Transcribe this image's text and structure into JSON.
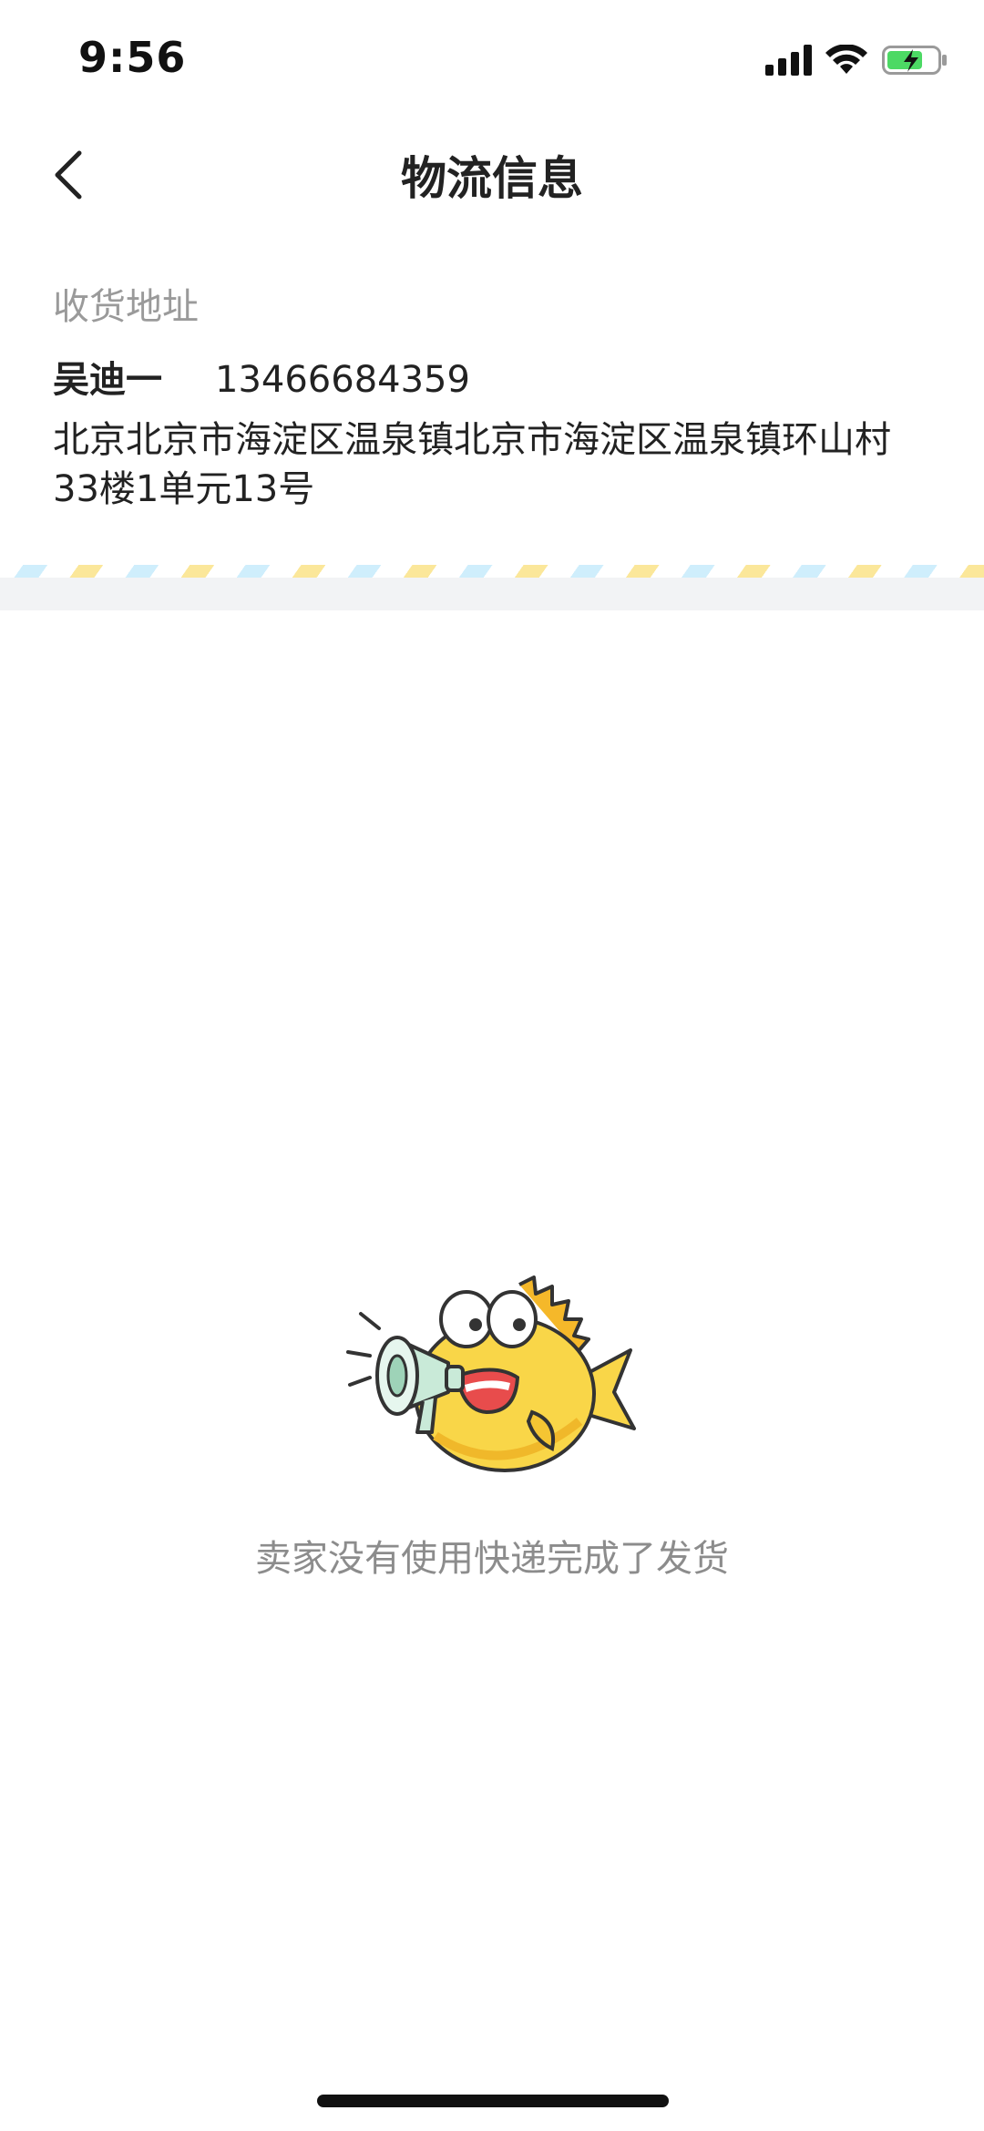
{
  "status_bar": {
    "time": "9:56"
  },
  "nav": {
    "title": "物流信息",
    "back_icon": "chevron-left-icon"
  },
  "address": {
    "label": "收货地址",
    "name": "吴迪一",
    "phone": "13466684359",
    "detail": "北京北京市海淀区温泉镇北京市海淀区温泉镇环山村33楼1单元13号"
  },
  "empty_state": {
    "mascot_icon": "fish-megaphone-icon",
    "message": "卖家没有使用快递完成了发货"
  },
  "colors": {
    "stripe_yellow": "#fbe79a",
    "stripe_blue": "#cfeefc",
    "mascot_yellow": "#f9d648",
    "divider": "#f2f3f5"
  }
}
